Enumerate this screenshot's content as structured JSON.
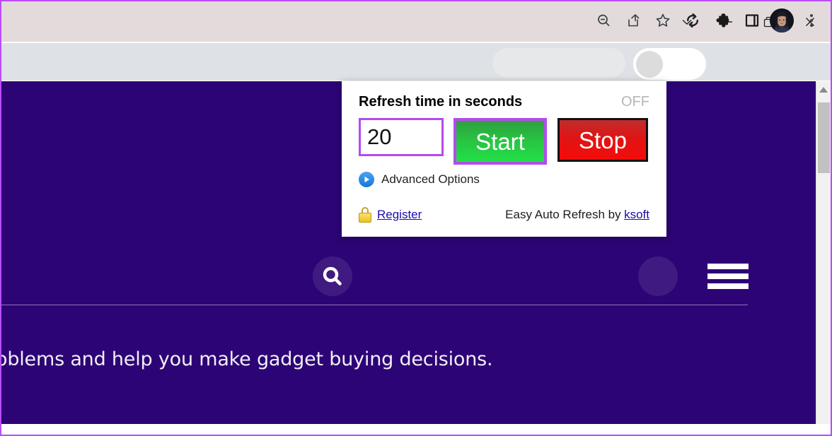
{
  "window": {
    "controls": [
      {
        "name": "tab-search-button",
        "glyph": "chevron-down"
      },
      {
        "name": "minimize-button",
        "glyph": "minimize"
      },
      {
        "name": "restore-button",
        "glyph": "restore"
      },
      {
        "name": "close-button",
        "glyph": "close"
      }
    ]
  },
  "toolbar": {
    "icons": [
      {
        "name": "zoom-out-icon",
        "label": "Zoom out"
      },
      {
        "name": "share-icon",
        "label": "Share this page"
      },
      {
        "name": "bookmark-star-icon",
        "label": "Bookmark this tab"
      },
      {
        "name": "refresh-extension-icon",
        "label": "Easy Auto Refresh"
      },
      {
        "name": "extensions-puzzle-icon",
        "label": "Extensions"
      },
      {
        "name": "side-panel-icon",
        "label": "Side panel"
      },
      {
        "name": "profile-avatar",
        "label": "Profile"
      },
      {
        "name": "chrome-menu-icon",
        "label": "Customize and control Google Chrome"
      }
    ]
  },
  "popup": {
    "title": "Refresh time in seconds",
    "status": "OFF",
    "seconds_value": "20",
    "seconds_placeholder": "",
    "start_label": "Start",
    "stop_label": "Stop",
    "advanced_label": "Advanced Options",
    "register_label": "Register",
    "credit_text": "Easy Auto Refresh by",
    "credit_link": "ksoft",
    "colors": {
      "highlight": "#b44aee",
      "start_green": "#22e148",
      "stop_red": "#f40b0b",
      "link_blue": "#1a0dab",
      "status_gray": "#b6b6b6"
    }
  },
  "page": {
    "tagline": "oblems and help you make gadget buying decisions.",
    "background_color": "#2d0475",
    "search_icon_name": "site-search-icon",
    "menu_icon_name": "site-hamburger-menu"
  },
  "scrollbar": {
    "up_arrow_name": "scroll-up-arrow",
    "thumb_name": "scroll-thumb"
  }
}
